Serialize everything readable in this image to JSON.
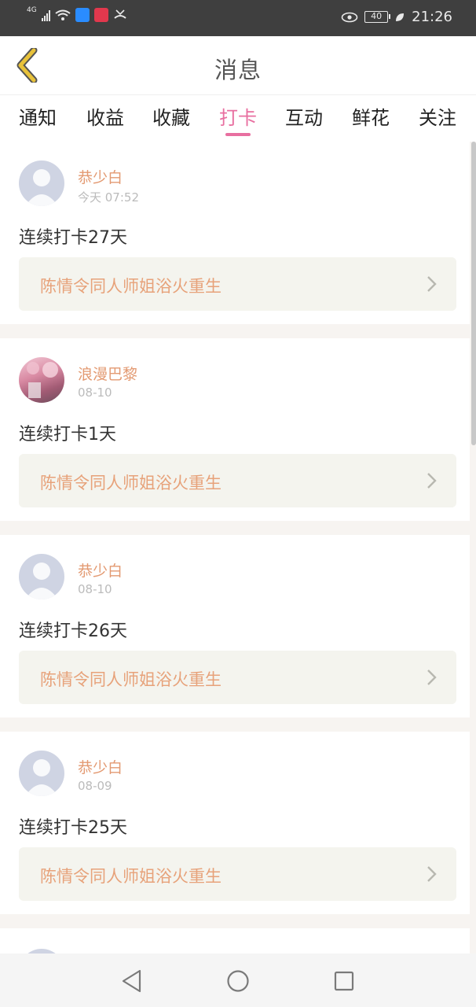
{
  "status_bar": {
    "network": "4G",
    "battery": "40",
    "time": "21:26"
  },
  "header": {
    "title": "消息",
    "back_icon": "chevron-left-icon"
  },
  "tabs": [
    {
      "label": "通知",
      "active": false
    },
    {
      "label": "收益",
      "active": false
    },
    {
      "label": "收藏",
      "active": false
    },
    {
      "label": "打卡",
      "active": true
    },
    {
      "label": "互动",
      "active": false
    },
    {
      "label": "鲜花",
      "active": false
    },
    {
      "label": "关注",
      "active": false
    }
  ],
  "messages": [
    {
      "user": "恭少白",
      "time": "今天 07:52",
      "text": "连续打卡27天",
      "link": "陈情令同人师姐浴火重生",
      "avatar": "default-avatar"
    },
    {
      "user": "浪漫巴黎",
      "time": "08-10",
      "text": "连续打卡1天",
      "link": "陈情令同人师姐浴火重生",
      "avatar": "photo-avatar"
    },
    {
      "user": "恭少白",
      "time": "08-10",
      "text": "连续打卡26天",
      "link": "陈情令同人师姐浴火重生",
      "avatar": "default-avatar"
    },
    {
      "user": "恭少白",
      "time": "08-09",
      "text": "连续打卡25天",
      "link": "陈情令同人师姐浴火重生",
      "avatar": "default-avatar"
    }
  ],
  "colors": {
    "accent": "#e86fa0",
    "username": "#e39a72",
    "link_text": "#e7a27a",
    "back_icon": "#e8c23a"
  }
}
